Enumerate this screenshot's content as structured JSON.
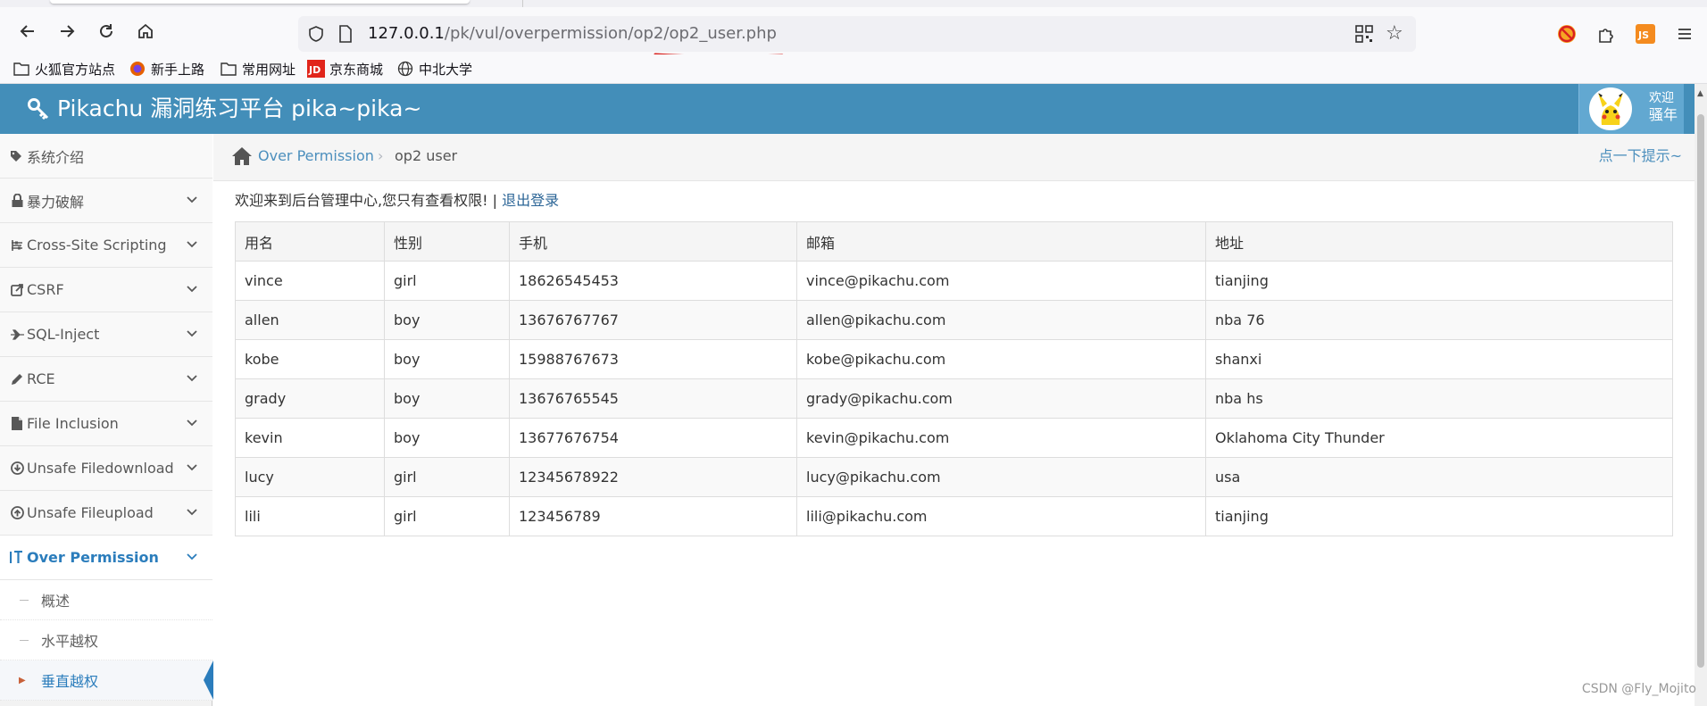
{
  "browser": {
    "url_host": "127.0.0.1",
    "url_path": "/pk/vul/overpermission/op2/op2_user.php"
  },
  "bookmarks": [
    {
      "label": "火狐官方站点",
      "icon": "folder-icon"
    },
    {
      "label": "新手上路",
      "icon": "firefox-icon"
    },
    {
      "label": "常用网址",
      "icon": "folder-icon"
    },
    {
      "label": "京东商城",
      "icon": "jd-icon"
    },
    {
      "label": "中北大学",
      "icon": "globe-icon"
    }
  ],
  "header": {
    "title": "Pikachu 漏洞练习平台 pika~pika~",
    "welcome": "欢迎",
    "username": "骚年"
  },
  "sidebar": {
    "items": [
      {
        "label": "系统介绍",
        "icon": "tags-icon"
      },
      {
        "label": "暴力破解",
        "icon": "lock-icon"
      },
      {
        "label": "Cross-Site Scripting",
        "icon": "sliders-icon"
      },
      {
        "label": "CSRF",
        "icon": "share-icon"
      },
      {
        "label": "SQL-Inject",
        "icon": "plane-icon"
      },
      {
        "label": "RCE",
        "icon": "pencil-icon"
      },
      {
        "label": "File Inclusion",
        "icon": "file-icon"
      },
      {
        "label": "Unsafe Filedownload",
        "icon": "download-icon"
      },
      {
        "label": "Unsafe Fileupload",
        "icon": "upload-icon"
      },
      {
        "label": "Over Permission",
        "icon": "text-height-icon"
      }
    ],
    "sub_items": [
      {
        "label": "概述"
      },
      {
        "label": "水平越权"
      },
      {
        "label": "垂直越权"
      }
    ]
  },
  "breadcrumb": {
    "section": "Over Permission",
    "current": "op2 user",
    "hint": "点一下提示~"
  },
  "main": {
    "welcome_text": "欢迎来到后台管理中心,您只有查看权限! |",
    "logout_label": "退出登录"
  },
  "table": {
    "headers": [
      "用名",
      "性别",
      "手机",
      "邮箱",
      "地址"
    ],
    "rows": [
      [
        "vince",
        "girl",
        "18626545453",
        "vince@pikachu.com",
        "tianjing"
      ],
      [
        "allen",
        "boy",
        "13676767767",
        "allen@pikachu.com",
        "nba 76"
      ],
      [
        "kobe",
        "boy",
        "15988767673",
        "kobe@pikachu.com",
        "shanxi"
      ],
      [
        "grady",
        "boy",
        "13676765545",
        "grady@pikachu.com",
        "nba hs"
      ],
      [
        "kevin",
        "boy",
        "13677676754",
        "kevin@pikachu.com",
        "Oklahoma City Thunder"
      ],
      [
        "lucy",
        "girl",
        "12345678922",
        "lucy@pikachu.com",
        "usa"
      ],
      [
        "lili",
        "girl",
        "123456789",
        "lili@pikachu.com",
        "tianjing"
      ]
    ]
  },
  "watermark": "CSDN @Fly_Mojito",
  "colors": {
    "header": "#438eb9",
    "userbox": "#62a8d1",
    "link": "#4c8fbd",
    "active": "#2b7dbc",
    "annotation": "#d9201c"
  }
}
